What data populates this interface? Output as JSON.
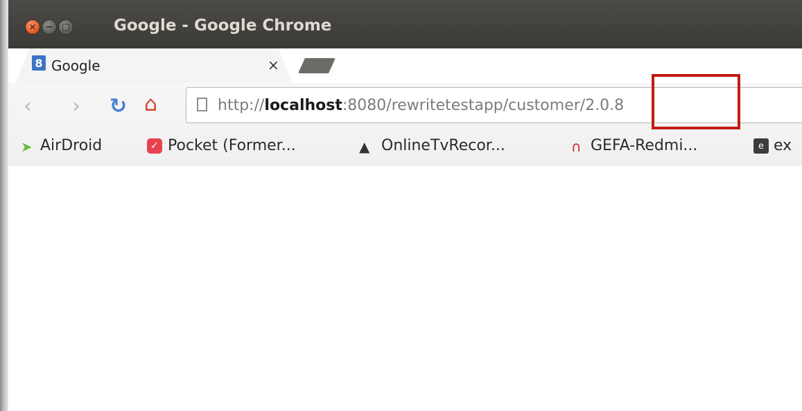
{
  "window": {
    "title": "Google - Google Chrome",
    "controls": {
      "close_icon": "close-icon",
      "minimize_icon": "minimize-icon",
      "maximize_icon": "maximize-icon"
    }
  },
  "tabs": [
    {
      "title": "Google",
      "favicon_letter": "8",
      "close_symbol": "×",
      "active": true
    }
  ],
  "toolbar": {
    "url_scheme": "http://",
    "url_host": "localhost",
    "url_rest": ":8080/rewritetestapp/customer/2.0.8"
  },
  "bookmarks": [
    {
      "label": "AirDroid"
    },
    {
      "label": "Pocket (Former..."
    },
    {
      "label": "OnlineTvRecor..."
    },
    {
      "label": "GEFA-Redmi..."
    },
    {
      "label": "ex"
    }
  ],
  "icons": {
    "back": "back-icon",
    "forward": "forward-icon",
    "reload": "reload-icon",
    "home": "home-icon",
    "page": "page-icon"
  },
  "colors": {
    "titlebar": "#3b3a37",
    "close_button": "#e0521c",
    "highlight": "#c41a14",
    "link_blue": "#4a7fd1"
  }
}
